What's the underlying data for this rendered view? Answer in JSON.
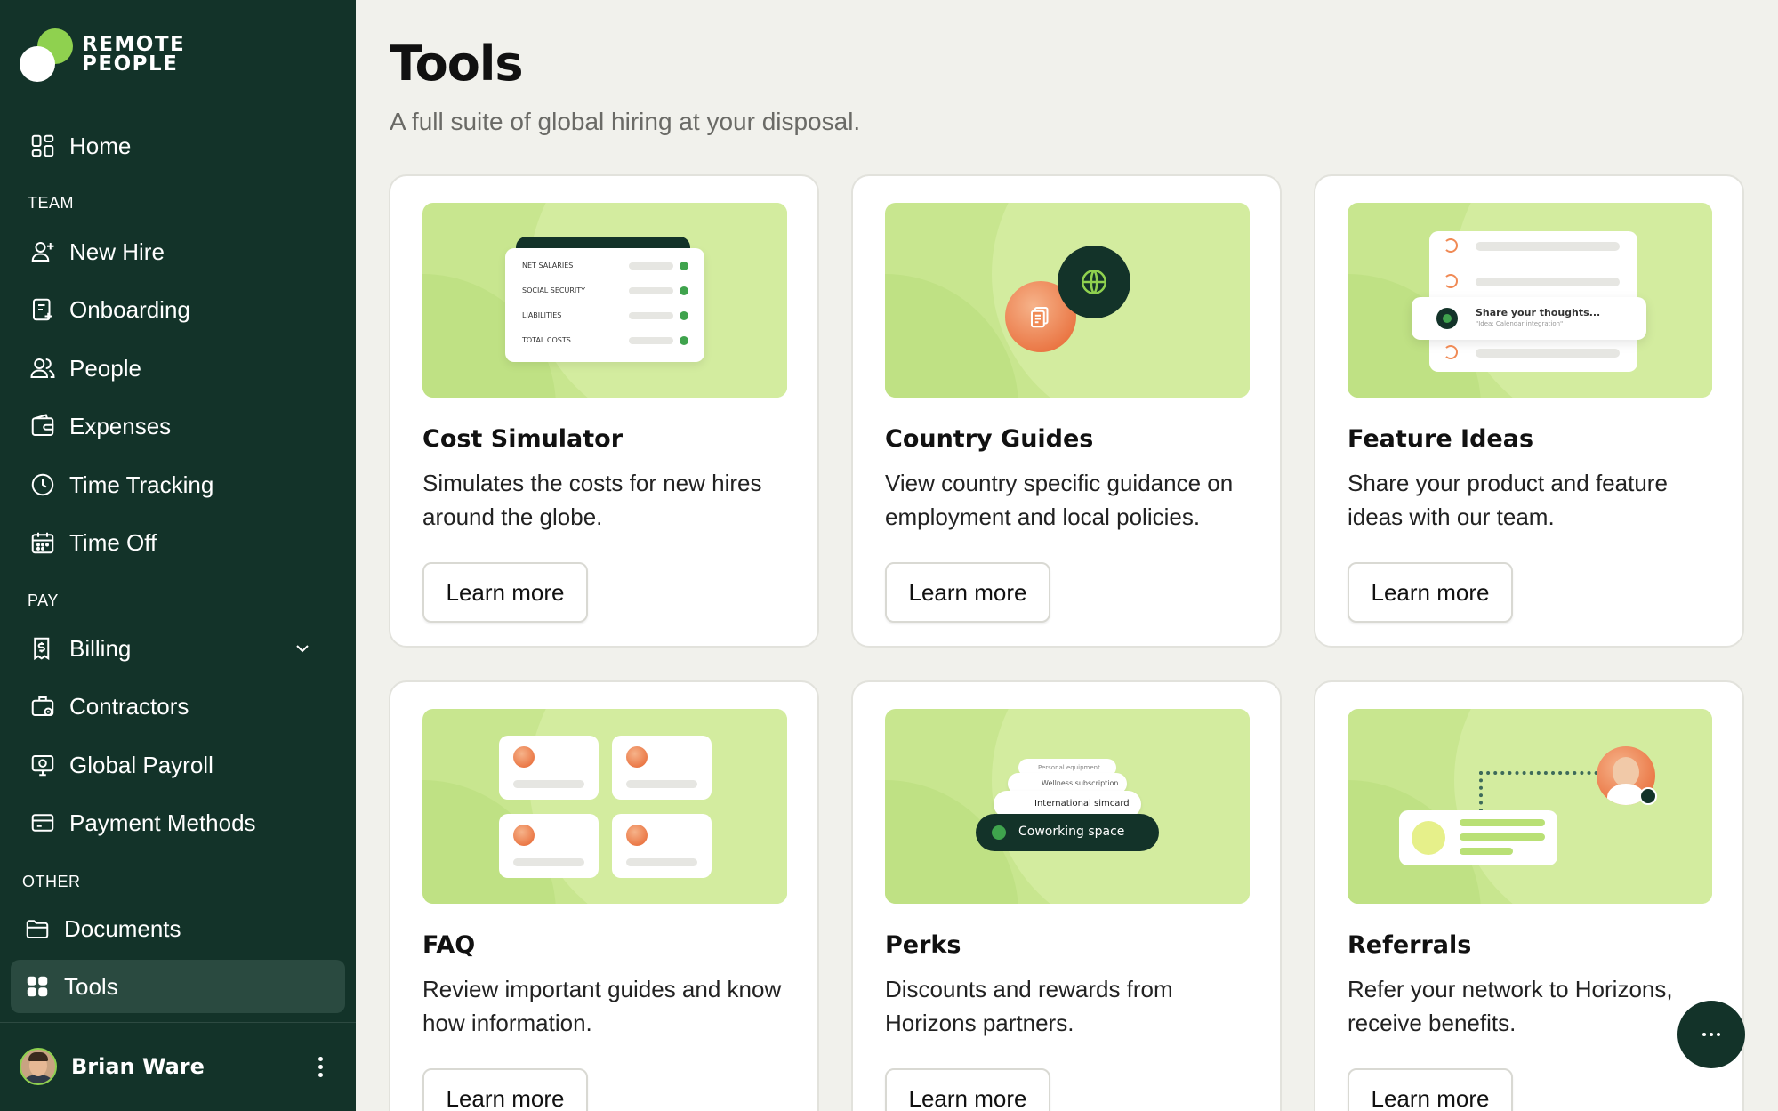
{
  "brand": {
    "line1": "REMOTE",
    "line2": "PEOPLE"
  },
  "sidebar": {
    "home": "Home",
    "sections": {
      "team": "TEAM",
      "pay": "PAY",
      "other": "OTHER"
    },
    "team_items": [
      "New Hire",
      "Onboarding",
      "People",
      "Expenses",
      "Time Tracking",
      "Time Off"
    ],
    "pay_items": [
      "Billing",
      "Contractors",
      "Global Payroll",
      "Payment Methods"
    ],
    "other_items": [
      "Documents",
      "Tools"
    ],
    "active": "Tools"
  },
  "user": {
    "name": "Brian Ware"
  },
  "page": {
    "title": "Tools",
    "subtitle": "A full suite of global hiring at your disposal."
  },
  "cards": [
    {
      "title": "Cost Simulator",
      "desc": "Simulates the costs for new hires around the globe.",
      "button": "Learn more",
      "illus": {
        "rows": [
          "NET SALARIES",
          "SOCIAL SECURITY",
          "LIABILITIES",
          "TOTAL COSTS"
        ]
      }
    },
    {
      "title": "Country Guides",
      "desc": "View country specific guidance on employment and local policies.",
      "button": "Learn more"
    },
    {
      "title": "Feature Ideas",
      "desc": "Share your product and feature ideas with our team.",
      "button": "Learn more",
      "illus": {
        "prompt": "Share your thoughts...",
        "hint": "\"Idea: Calendar integration\""
      }
    },
    {
      "title": "FAQ",
      "desc": "Review important guides and know how information.",
      "button": "Learn more"
    },
    {
      "title": "Perks",
      "desc": "Discounts and rewards from Horizons partners.",
      "button": "Learn more",
      "illus": {
        "perks": [
          "Personal equipment",
          "Wellness subscription",
          "International simcard",
          "Coworking space"
        ]
      }
    },
    {
      "title": "Referrals",
      "desc": "Refer your network to Horizons, receive benefits.",
      "button": "Learn more"
    }
  ],
  "colors": {
    "sidebar": "#133329",
    "accent": "#8fd14f",
    "illustration": "#c8e68f",
    "background": "#f1f1ec"
  }
}
